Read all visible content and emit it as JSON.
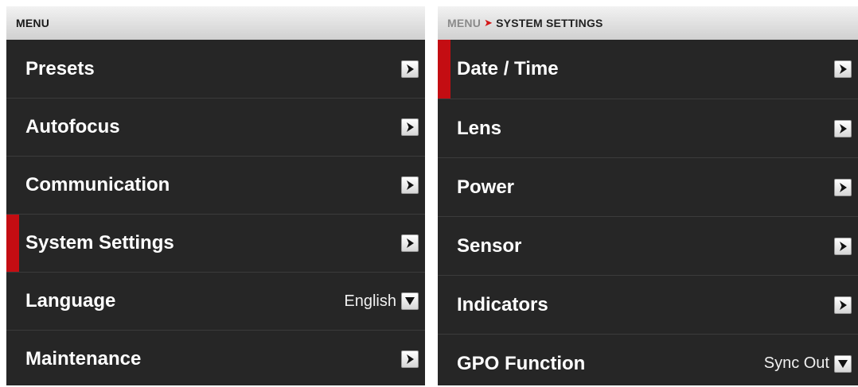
{
  "left_panel": {
    "breadcrumb": {
      "root": "MENU",
      "separator": "",
      "current": ""
    },
    "items": [
      {
        "label": "Presets",
        "value": "",
        "control": "arrow-right-icon",
        "selected": false
      },
      {
        "label": "Autofocus",
        "value": "",
        "control": "arrow-right-icon",
        "selected": false
      },
      {
        "label": "Communication",
        "value": "",
        "control": "arrow-right-icon",
        "selected": false
      },
      {
        "label": "System Settings",
        "value": "",
        "control": "arrow-right-icon",
        "selected": true
      },
      {
        "label": "Language",
        "value": "English",
        "control": "dropdown-arrow-icon",
        "selected": false
      },
      {
        "label": "Maintenance",
        "value": "",
        "control": "arrow-right-icon",
        "selected": false
      }
    ]
  },
  "right_panel": {
    "breadcrumb": {
      "root": "MENU",
      "separator": "➤",
      "current": "SYSTEM SETTINGS"
    },
    "items": [
      {
        "label": "Date / Time",
        "value": "",
        "control": "arrow-right-icon",
        "selected": true
      },
      {
        "label": "Lens",
        "value": "",
        "control": "arrow-right-icon",
        "selected": false
      },
      {
        "label": "Power",
        "value": "",
        "control": "arrow-right-icon",
        "selected": false
      },
      {
        "label": "Sensor",
        "value": "",
        "control": "arrow-right-icon",
        "selected": false
      },
      {
        "label": "Indicators",
        "value": "",
        "control": "arrow-right-icon",
        "selected": false
      },
      {
        "label": "GPO Function",
        "value": "Sync Out",
        "control": "dropdown-arrow-icon",
        "selected": false
      }
    ]
  },
  "colors": {
    "panel_bg": "#262626",
    "selection_marker": "#c40d12",
    "breadcrumb_separator": "#d41616",
    "header_bg": "#e0e0e0"
  }
}
